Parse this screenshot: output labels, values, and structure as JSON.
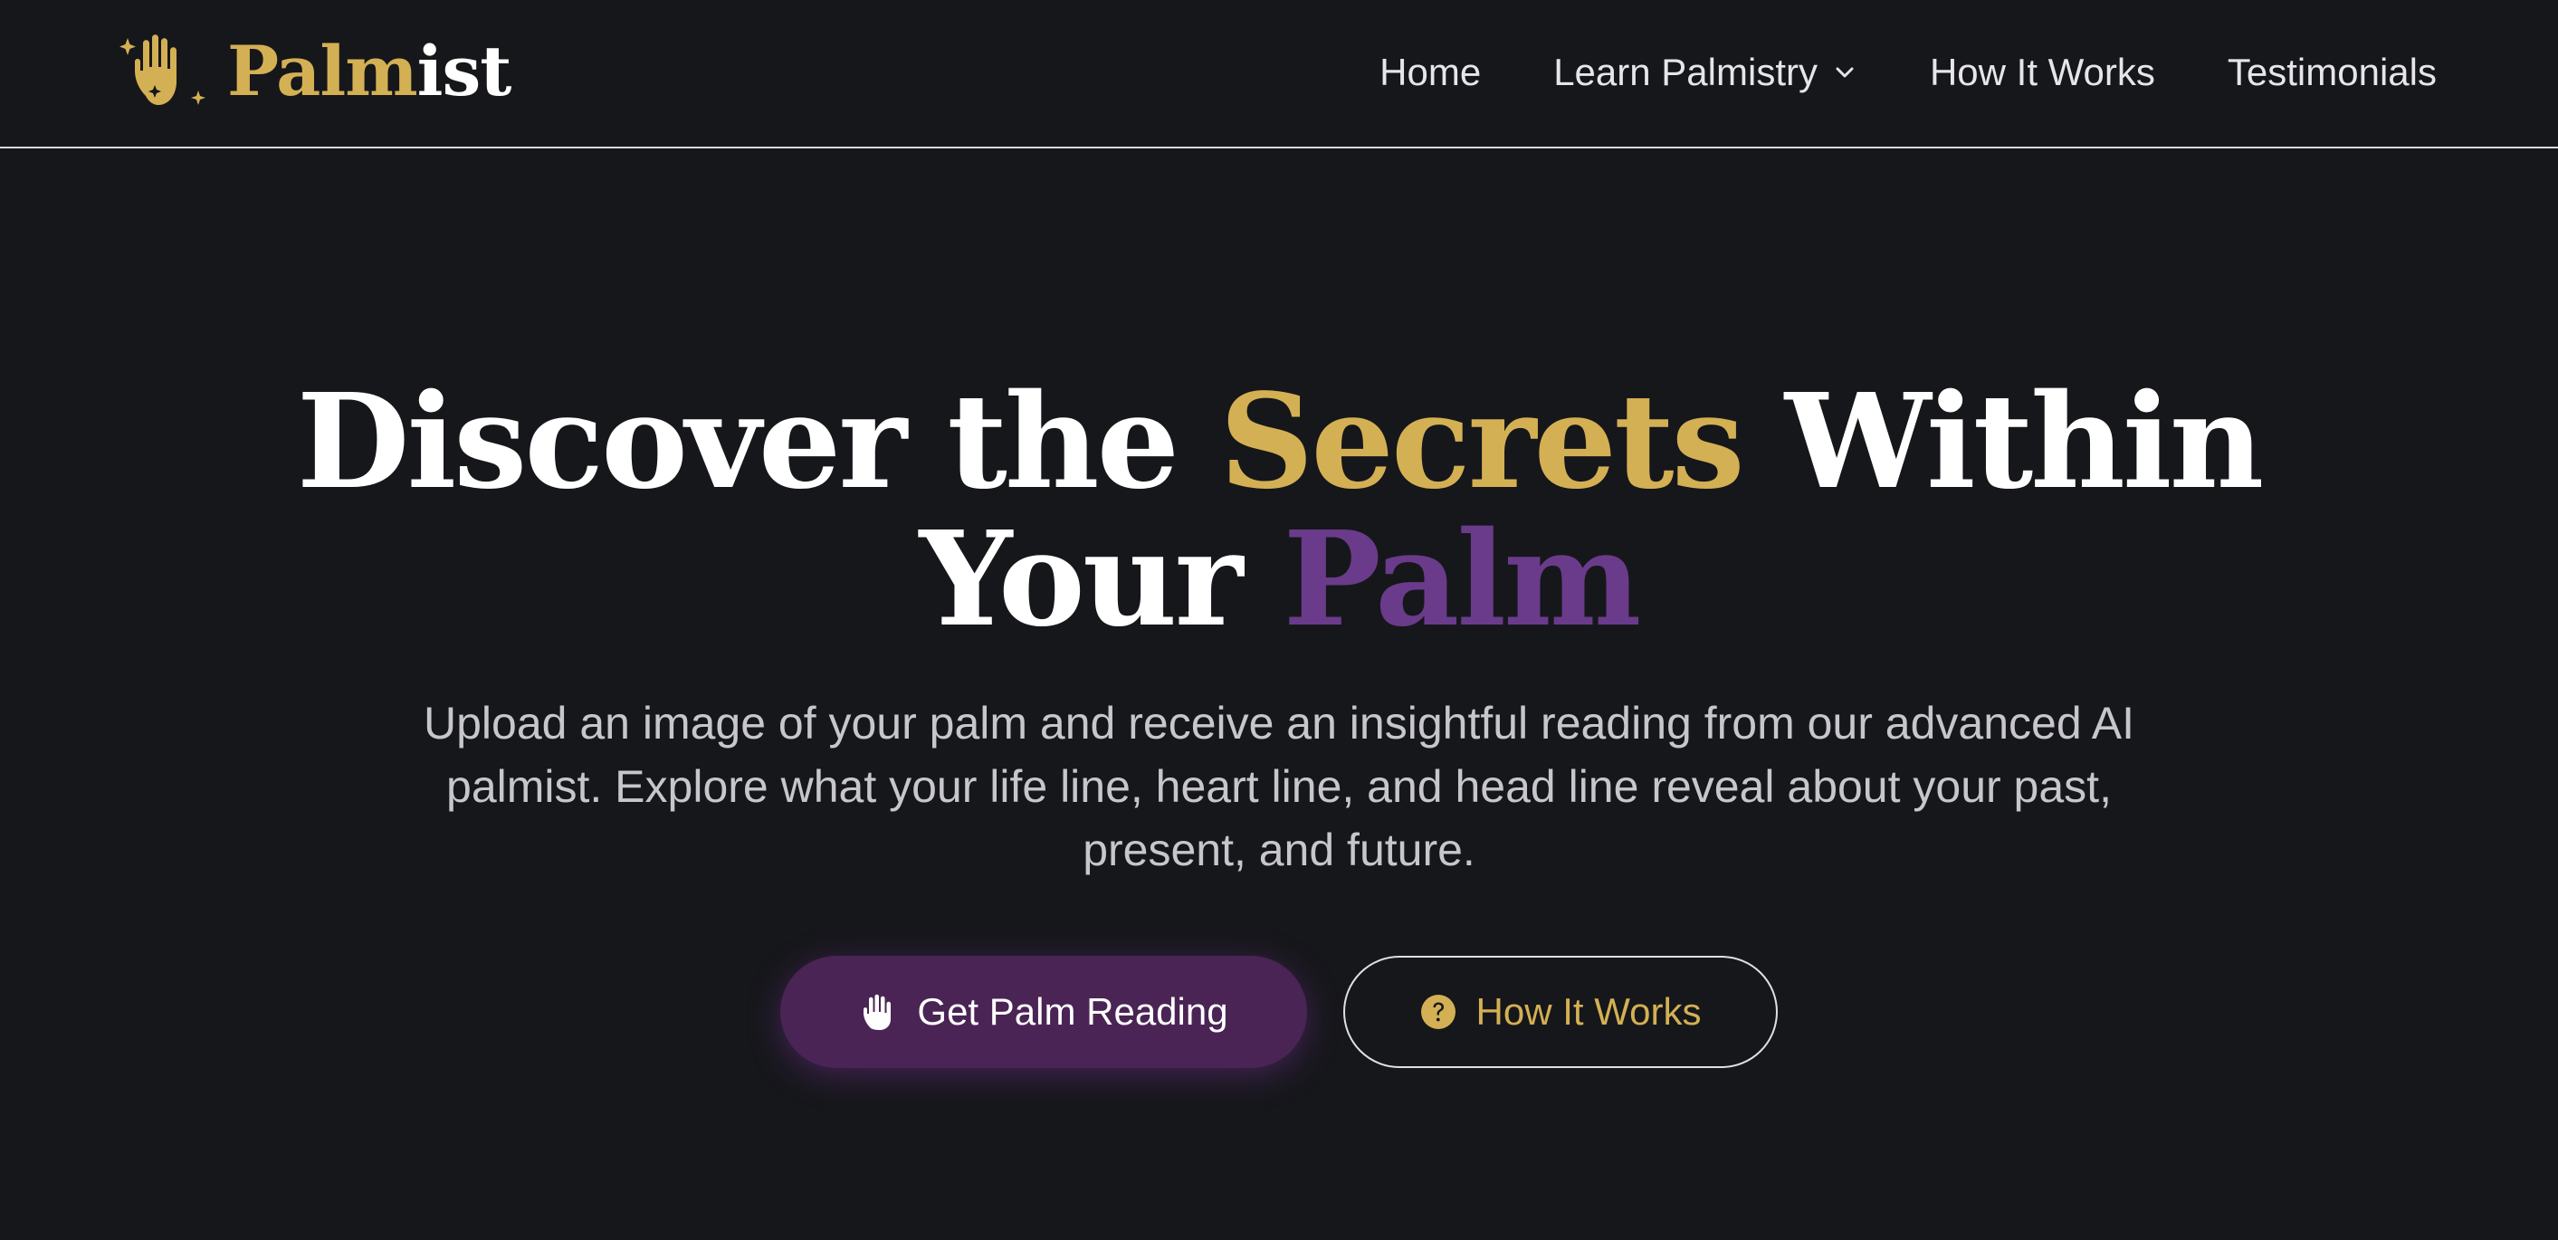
{
  "brand": {
    "name_part1": "Palm",
    "name_part2": "ist",
    "logo_icon": "hand-sparkles-icon",
    "gold": "#d4b054"
  },
  "nav": {
    "items": [
      {
        "label": "Home"
      },
      {
        "label": "Learn Palmistry",
        "dropdown_icon": "chevron-down-icon"
      },
      {
        "label": "How It Works"
      },
      {
        "label": "Testimonials"
      }
    ]
  },
  "hero": {
    "title_part1": "Discover the ",
    "title_highlight1": "Secrets",
    "title_part2": " Within",
    "title_part3": "Your ",
    "title_highlight2": "Palm",
    "subtitle": "Upload an image of your palm and receive an insightful reading from our advanced AI palmist. Explore what your life line, heart line, and head line reveal about your past, present, and future.",
    "primary_button": {
      "label": "Get Palm Reading",
      "icon": "hand-icon"
    },
    "secondary_button": {
      "label": "How It Works",
      "icon": "question-circle-icon"
    }
  },
  "colors": {
    "background": "#16171b",
    "gold": "#d4b054",
    "purple": "#6a3b8a",
    "button_purple": "#4a2455",
    "text_muted": "#c6c6cc"
  }
}
